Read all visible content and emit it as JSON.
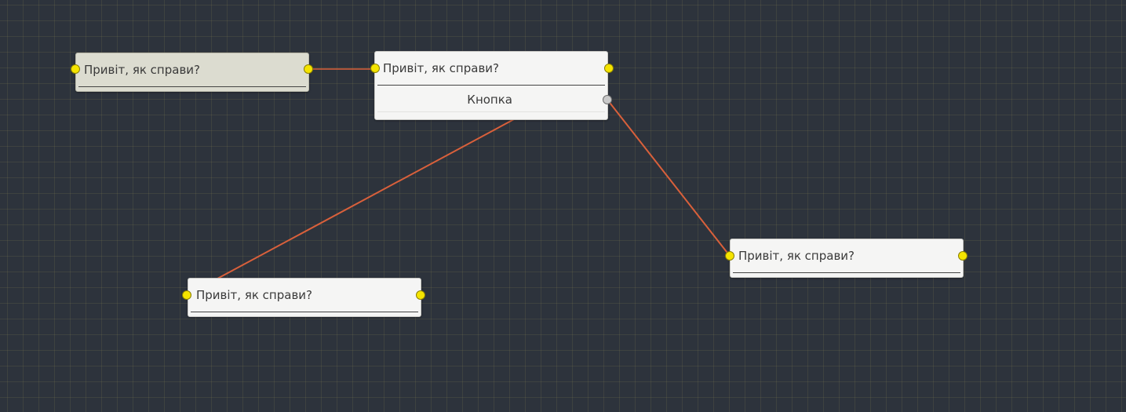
{
  "colors": {
    "canvas_background": "#2d333c",
    "grid_line": "#5b5a45",
    "node_background": "#f5f5f4",
    "node_selected_background": "#dcdcd0",
    "port_active": "#f5e400",
    "port_inactive": "#c9c9c9",
    "link_color": "#d9603b"
  },
  "nodes": [
    {
      "id": "node-1",
      "title": "Привіт, як справи?",
      "selected": true
    },
    {
      "id": "node-2",
      "title": "Привіт, як справи?",
      "button_label": "Кнопка"
    },
    {
      "id": "node-3",
      "title": "Привіт, як справи?"
    },
    {
      "id": "node-4",
      "title": "Привіт, як справи?"
    }
  ],
  "links": [
    {
      "from": "node-1.output",
      "to": "node-2.input"
    },
    {
      "from": "node-2.output",
      "to": "node-3.input"
    },
    {
      "from": "node-2.button-port",
      "to": "node-4.input"
    }
  ]
}
